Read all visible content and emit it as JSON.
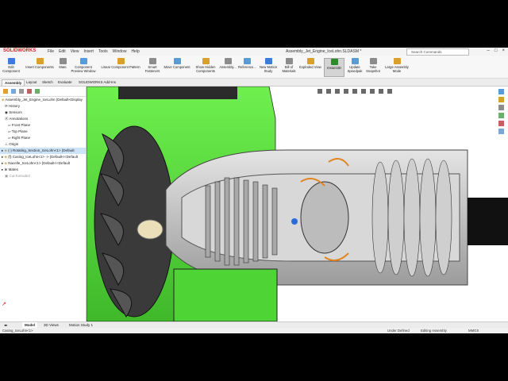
{
  "window": {
    "app_name": "SOLIDWORKS",
    "menu": [
      "File",
      "Edit",
      "View",
      "Insert",
      "Tools",
      "Window",
      "Help"
    ],
    "title": "Assembly_Jet_Engine_IceLohn.SLDASM *",
    "search_placeholder": "Search Commands"
  },
  "ribbon": {
    "buttons": [
      {
        "label": "Edit Component",
        "icon": "edit-component-icon",
        "color": "#3b7dd8"
      },
      {
        "label": "Insert Components",
        "icon": "insert-components-icon",
        "color": "#d9a02b"
      },
      {
        "label": "Mate",
        "icon": "mate-icon",
        "color": "#8c8c8c"
      },
      {
        "label": "Component Preview Window",
        "icon": "preview-window-icon",
        "color": "#5a9bd5"
      },
      {
        "label": "Linear Component Pattern",
        "icon": "linear-pattern-icon",
        "color": "#d9a02b"
      },
      {
        "label": "Smart Fasteners",
        "icon": "fastener-icon",
        "color": "#8c8c8c"
      },
      {
        "label": "Move Component",
        "icon": "move-component-icon",
        "color": "#5a9bd5"
      },
      {
        "label": "Show Hidden Components",
        "icon": "show-hidden-icon",
        "color": "#d9a02b"
      },
      {
        "label": "Assembly...",
        "icon": "assembly-features-icon",
        "color": "#8c8c8c"
      },
      {
        "label": "Reference...",
        "icon": "reference-geometry-icon",
        "color": "#5a9bd5"
      },
      {
        "label": "New Motion Study",
        "icon": "motion-study-icon",
        "color": "#3b7dd8"
      },
      {
        "label": "Bill of Materials",
        "icon": "bom-icon",
        "color": "#8c8c8c"
      },
      {
        "label": "Exploded View",
        "icon": "exploded-view-icon",
        "color": "#d9a02b"
      },
      {
        "label": "Instant3D",
        "icon": "instant3d-icon",
        "color": "#2d8a2d"
      },
      {
        "label": "Update Speedpak",
        "icon": "speedpak-icon",
        "color": "#5a9bd5"
      },
      {
        "label": "Take Snapshot",
        "icon": "snapshot-icon",
        "color": "#8c8c8c"
      },
      {
        "label": "Large Assembly Mode",
        "icon": "large-assembly-icon",
        "color": "#d9a02b"
      }
    ]
  },
  "command_tabs": [
    "Assembly",
    "Layout",
    "Sketch",
    "Evaluate",
    "SOLIDWORKS Add-Ins"
  ],
  "tree": {
    "root": "Assembly_Jet_Engine_IceLohn (Default<Display",
    "items": [
      {
        "label": "History",
        "indent": 1
      },
      {
        "label": "Sensors",
        "indent": 1
      },
      {
        "label": "Annotations",
        "indent": 1
      },
      {
        "label": "Front Plane",
        "indent": 2
      },
      {
        "label": "Top Plane",
        "indent": 2
      },
      {
        "label": "Right Plane",
        "indent": 2
      },
      {
        "label": "Origin",
        "indent": 1
      },
      {
        "label": "(-) Rotating_Section_IceLohn<1> (Default",
        "indent": 1,
        "selected": true
      },
      {
        "label": "(f) Casing_IceLohn<1> -> (Default<<Default",
        "indent": 1
      },
      {
        "label": "Nacelle_IceLohn<1> (Default<<Default",
        "indent": 1
      },
      {
        "label": "Mates",
        "indent": 1
      },
      {
        "label": "Cut-Extrude2",
        "indent": 1
      }
    ]
  },
  "bottom_tabs": [
    "Model",
    "3D Views",
    "Motion Study 1"
  ],
  "status": {
    "selection": "Casing_IceLohn<1>",
    "state": "Under Defined",
    "mode": "Editing Assembly",
    "units": "MMGS"
  },
  "colors": {
    "nacelle_green": "#57e63c",
    "casing_gray": "#c8c8c8",
    "accent_orange": "#e0851f",
    "selection_blue": "#cde3f7"
  }
}
